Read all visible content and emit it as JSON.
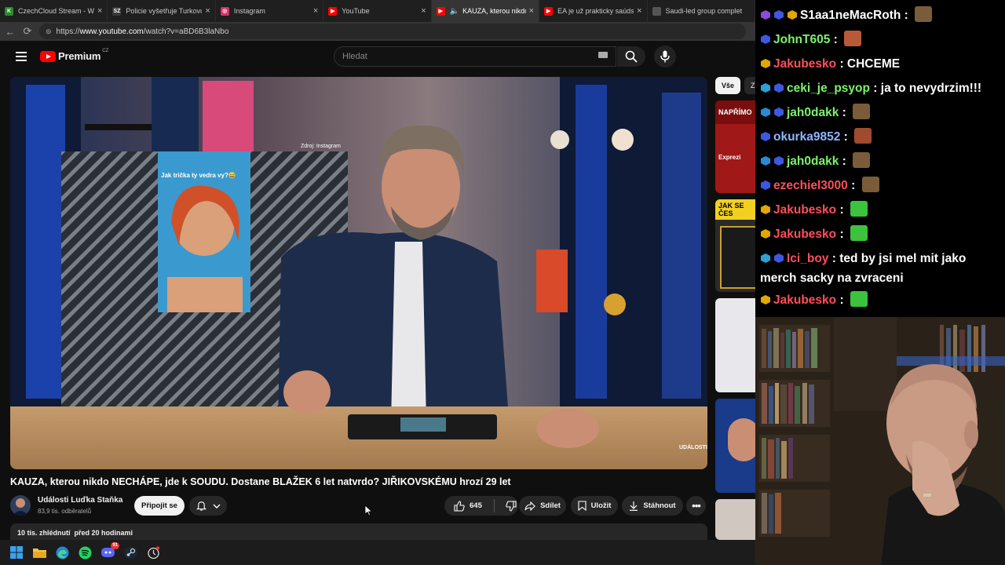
{
  "tabs": [
    {
      "title": "CzechCloud Stream - Watch",
      "icon": "czechcloud-icon",
      "color": "#2a8a2a",
      "glyph": "K",
      "active": false
    },
    {
      "title": "Policie vyšetřuje Turkovu ne",
      "icon": "sz-icon",
      "color": "#3a3a3a",
      "glyph": "SZ",
      "active": false
    },
    {
      "title": "Instagram",
      "icon": "instagram-icon",
      "color": "#d6306a",
      "glyph": "◎",
      "active": false
    },
    {
      "title": "YouTube",
      "icon": "youtube-icon",
      "color": "#ff0000",
      "glyph": "▶",
      "active": false
    },
    {
      "title": "KAUZA, kterou nikdo NE",
      "icon": "youtube-icon",
      "color": "#ff0000",
      "glyph": "▶",
      "active": true
    },
    {
      "title": "EA je už prakticky saúdská. E",
      "icon": "youtube-icon",
      "color": "#ff0000",
      "glyph": "▶",
      "active": false
    },
    {
      "title": "Saudi-led group complet",
      "icon": "page-icon",
      "color": "#555555",
      "glyph": "",
      "active": false
    }
  ],
  "address": {
    "prefix": "https://",
    "host": "www.youtube.com",
    "path": "/watch?v=aBD6B3laNbo"
  },
  "header": {
    "brand": "Premium",
    "region": "CZ",
    "search_placeholder": "Hledat"
  },
  "video": {
    "title": "KAUZA, kterou nikdo NECHÁPE, jde k SOUDU. Dostane BLAŽEK 6 let natvrdo? JIŘIKOVSKÉMU hrozí 29 let",
    "inset_caption": "Jak trička ty vedra vy?😅",
    "inset_source": "Zdroj: Instagram",
    "watermark": "UDÁLOSTI"
  },
  "channel": {
    "name": "Události Luďka Staňka",
    "subs": "83,9 tis. odběratelů",
    "join_label": "Připojit se"
  },
  "actions": {
    "likes": "645",
    "share": "Sdílet",
    "save": "Uložit",
    "download": "Stáhnout"
  },
  "description": {
    "stats": "10 tis. zhlédnutí  před 20 hodinami"
  },
  "sidebar": {
    "chip_all": "Vše",
    "chip_next": "Z",
    "thumb1_text": "NAPŘÍMO",
    "thumb1_sub": "Exprezi",
    "thumb2_text": "JAK SE ČES"
  },
  "chat": [
    {
      "badges": [
        "#8a4bd6",
        "#3f57e0",
        "#e0a800"
      ],
      "user": "S1aa1neMacRoth",
      "color": "#ffffff",
      "text": "",
      "emote": "#7a5c3a"
    },
    {
      "badges": [
        "#3f57e0"
      ],
      "user": "JohnT605",
      "color": "#7cf36a",
      "text": "",
      "emote": "#b85a3a"
    },
    {
      "badges": [
        "#e0a800"
      ],
      "user": "Jakubesko",
      "color": "#ff4f5a",
      "text": "CHCEME",
      "emote": ""
    },
    {
      "badges": [
        "#2aa1d8",
        "#3f57e0"
      ],
      "user": "ceki_je_psyop",
      "color": "#7cf36a",
      "text": "ja to nevydrzim!!!",
      "emote": ""
    },
    {
      "badges": [
        "#2a8ad8",
        "#3f57e0"
      ],
      "user": "jah0dakk",
      "color": "#7cf36a",
      "text": "",
      "emote": "#7a5c3a"
    },
    {
      "badges": [
        "#3f57e0"
      ],
      "user": "okurka9852",
      "color": "#8fb6ff",
      "text": "",
      "emote": "#a04a30"
    },
    {
      "badges": [
        "#2a8ad8",
        "#3f57e0"
      ],
      "user": "jah0dakk",
      "color": "#7cf36a",
      "text": "",
      "emote": "#7a5c3a"
    },
    {
      "badges": [
        "#3f57e0"
      ],
      "user": "ezechiel3000",
      "color": "#ff4f5a",
      "text": "",
      "emote": "#7a5c3a"
    },
    {
      "badges": [
        "#e0a800"
      ],
      "user": "Jakubesko",
      "color": "#ff4f5a",
      "text": "",
      "emote": "#3cc23c"
    },
    {
      "badges": [
        "#e0a800"
      ],
      "user": "Jakubesko",
      "color": "#ff4f5a",
      "text": "",
      "emote": "#3cc23c"
    },
    {
      "badges": [
        "#2aa1d8",
        "#3f57e0"
      ],
      "user": "Ici_boy",
      "color": "#ff4f5a",
      "text": "ted by jsi mel mit jako merch sacky na zvraceni",
      "emote": ""
    },
    {
      "badges": [
        "#e0a800"
      ],
      "user": "Jakubesko",
      "color": "#ff4f5a",
      "text": "",
      "emote": "#3cc23c"
    }
  ],
  "taskbar": [
    "start-icon",
    "file-explorer-icon",
    "edge-icon",
    "spotify-icon",
    "discord-icon",
    "steam-icon",
    "app-icon"
  ],
  "discord_badge": "91"
}
